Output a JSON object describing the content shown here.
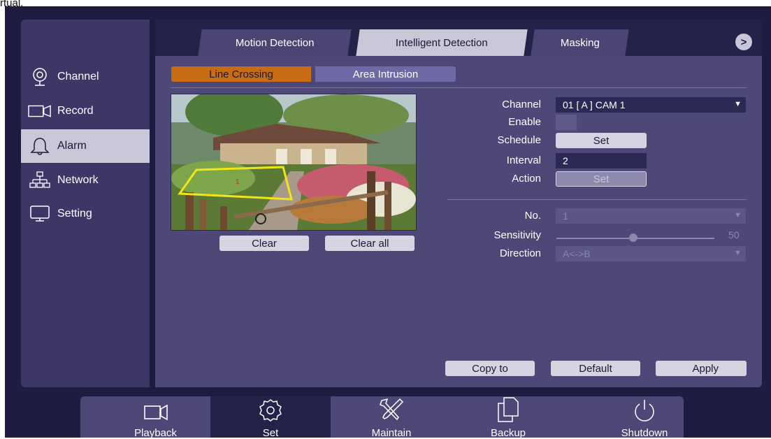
{
  "page_label": "rtual.",
  "sidebar": {
    "items": [
      {
        "label": "Channel",
        "icon": "camera-icon"
      },
      {
        "label": "Record",
        "icon": "video-record-icon"
      },
      {
        "label": "Alarm",
        "icon": "bell-icon",
        "active": true
      },
      {
        "label": "Network",
        "icon": "network-icon"
      },
      {
        "label": "Setting",
        "icon": "monitor-icon"
      }
    ]
  },
  "tabs": [
    {
      "label": "Motion Detection"
    },
    {
      "label": "Intelligent Detection",
      "active": true
    },
    {
      "label": "Masking"
    }
  ],
  "next_button": ">",
  "subtabs": [
    {
      "label": "Line Crossing",
      "active": true
    },
    {
      "label": "Area Intrusion"
    }
  ],
  "preview": {
    "buttons": {
      "clear": "Clear",
      "clear_all": "Clear all"
    },
    "zone_marker": "1"
  },
  "form": {
    "channel_label": "Channel",
    "channel_value": "01 [ A ] CAM 1",
    "enable_label": "Enable",
    "schedule_label": "Schedule",
    "schedule_button": "Set",
    "interval_label": "Interval",
    "interval_value": "2",
    "action_label": "Action",
    "action_button": "Set",
    "no_label": "No.",
    "no_value": "1",
    "sensitivity_label": "Sensitivity",
    "sensitivity_value": "50",
    "direction_label": "Direction",
    "direction_value": "A<->B"
  },
  "footer_buttons": {
    "copy": "Copy to",
    "default": "Default",
    "apply": "Apply"
  },
  "dock": [
    {
      "label": "Playback",
      "icon": "playback-icon"
    },
    {
      "label": "Set",
      "icon": "gear-icon",
      "active": true
    },
    {
      "label": "Maintain",
      "icon": "tools-icon"
    },
    {
      "label": "Backup",
      "icon": "backup-icon"
    },
    {
      "label": "Shutdown",
      "icon": "power-icon"
    }
  ],
  "colors": {
    "accent_orange": "#c86c14",
    "panel": "#4e4878",
    "active_tab": "#c9c6d8",
    "background": "#1f1c42"
  }
}
